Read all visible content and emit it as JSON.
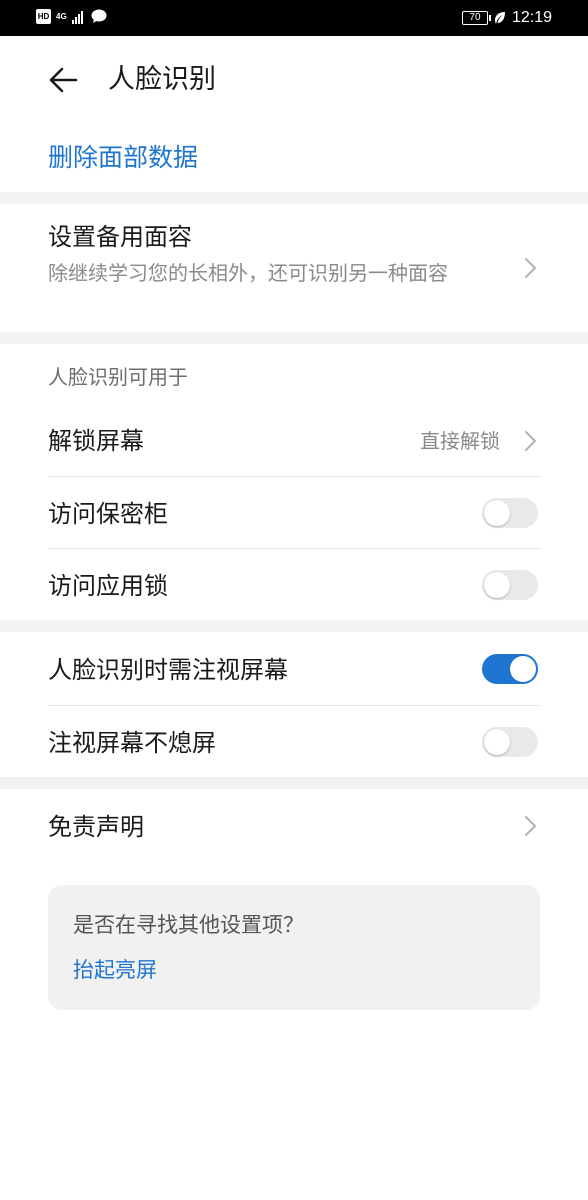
{
  "status_bar": {
    "hd": "HD",
    "network": "4G",
    "battery": "70",
    "time": "12:19"
  },
  "header": {
    "title": "人脸识别"
  },
  "delete_action": "删除面部数据",
  "alt_face": {
    "title": "设置备用面容",
    "description": "除继续学习您的长相外，还可识别另一种面容"
  },
  "usage": {
    "section_title": "人脸识别可用于",
    "unlock": {
      "label": "解锁屏幕",
      "value": "直接解锁"
    },
    "vault": {
      "label": "访问保密柜",
      "enabled": false
    },
    "app_lock": {
      "label": "访问应用锁",
      "enabled": false
    }
  },
  "attention": {
    "require_gaze": {
      "label": "人脸识别时需注视屏幕",
      "enabled": true
    },
    "gaze_awake": {
      "label": "注视屏幕不熄屏",
      "enabled": false
    }
  },
  "disclaimer": {
    "label": "免责声明"
  },
  "suggestion": {
    "question": "是否在寻找其他设置项？",
    "link": "抬起亮屏"
  },
  "colors": {
    "accent": "#1f75cf",
    "divider": "#f2f2f2"
  }
}
